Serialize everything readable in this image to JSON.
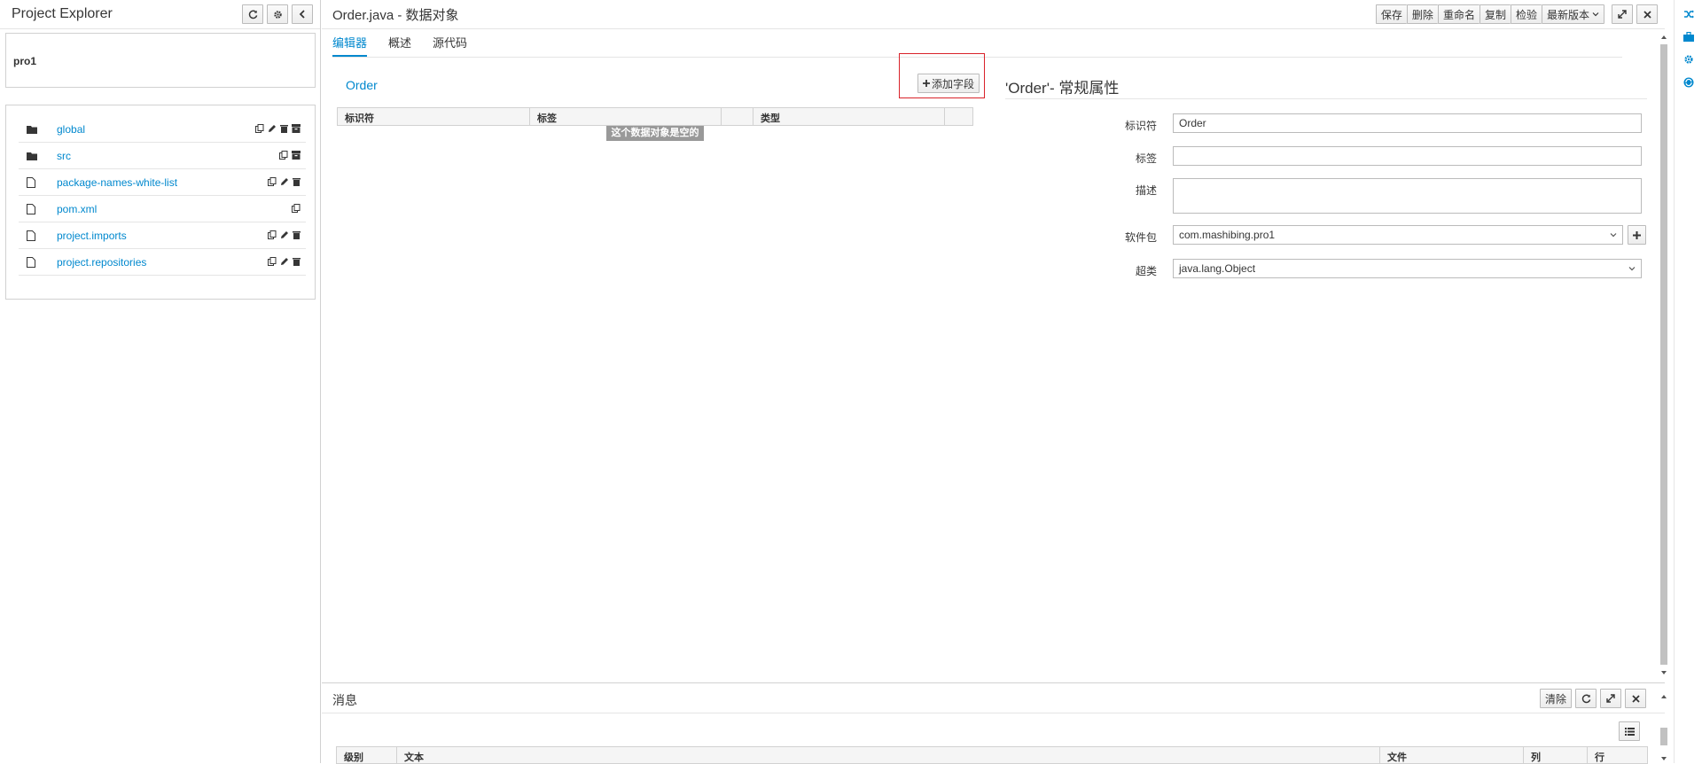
{
  "left_panel": {
    "title": "Project Explorer",
    "project_name": "pro1",
    "tree": [
      {
        "name": "global",
        "type": "folder",
        "actions": [
          "copy",
          "edit",
          "delete",
          "archive"
        ]
      },
      {
        "name": "src",
        "type": "folder",
        "actions": [
          "copy",
          "archive"
        ]
      },
      {
        "name": "package-names-white-list",
        "type": "file",
        "actions": [
          "copy",
          "edit",
          "delete"
        ]
      },
      {
        "name": "pom.xml",
        "type": "file",
        "actions": [
          "copy"
        ]
      },
      {
        "name": "project.imports",
        "type": "file",
        "actions": [
          "copy",
          "edit",
          "delete"
        ]
      },
      {
        "name": "project.repositories",
        "type": "file",
        "actions": [
          "copy",
          "edit",
          "delete"
        ]
      }
    ]
  },
  "editor": {
    "title": "Order.java - 数据对象",
    "toolbar": {
      "save": "保存",
      "delete": "删除",
      "rename": "重命名",
      "copy": "复制",
      "validate": "检验",
      "latest_version": "最新版本"
    },
    "tabs": [
      "编辑器",
      "概述",
      "源代码"
    ],
    "active_tab": 0,
    "object_name": "Order",
    "add_field_label": "添加字段",
    "table_headers": [
      "标识符",
      "标签",
      "",
      "类型",
      ""
    ],
    "empty_message": "这个数据对象是空的",
    "props": {
      "title": "'Order'- 常规属性",
      "identifier_label": "标识符",
      "identifier_value": "Order",
      "label_label": "标签",
      "label_value": "",
      "description_label": "描述",
      "description_value": "",
      "package_label": "软件包",
      "package_value": "com.mashibing.pro1",
      "superclass_label": "超类",
      "superclass_value": "java.lang.Object"
    }
  },
  "messages": {
    "title": "消息",
    "clear_label": "清除",
    "table_headers": [
      "级别",
      "文本",
      "文件",
      "列",
      "行"
    ]
  },
  "colors": {
    "accent": "#0088ce",
    "highlight": "#d9222a",
    "border": "#d1d1d1"
  }
}
